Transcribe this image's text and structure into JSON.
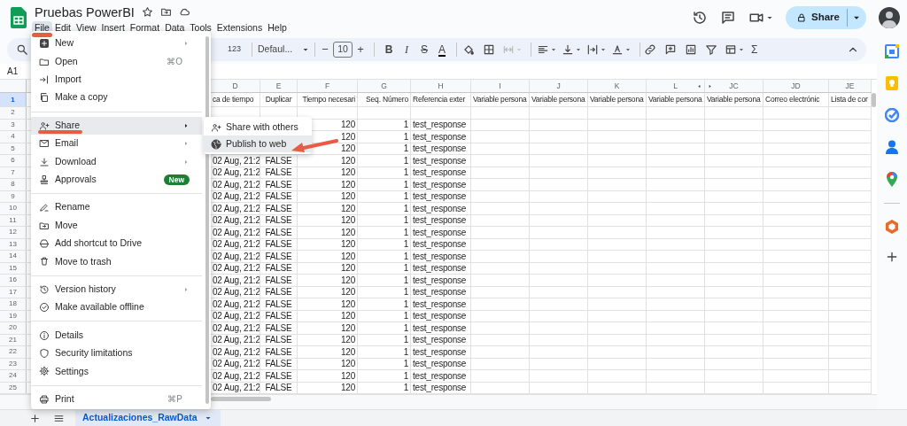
{
  "window": {
    "title": "Pruebas PowerBI"
  },
  "menu_bar": [
    {
      "label": "File",
      "selected": true,
      "annotated": true
    },
    {
      "label": "Edit",
      "selected": false,
      "annotated": false
    },
    {
      "label": "View",
      "selected": false,
      "annotated": false
    },
    {
      "label": "Insert",
      "selected": false,
      "annotated": false
    },
    {
      "label": "Format",
      "selected": false,
      "annotated": false
    },
    {
      "label": "Data",
      "selected": false,
      "annotated": false
    },
    {
      "label": "Tools",
      "selected": false,
      "annotated": false
    },
    {
      "label": "Extensions",
      "selected": false,
      "annotated": false
    },
    {
      "label": "Help",
      "selected": false,
      "annotated": false
    }
  ],
  "share_button": {
    "label": "Share"
  },
  "toolbar": {
    "number_format": "123",
    "font": "Defaul...",
    "font_size": "10",
    "decrease": "−",
    "increase": "+",
    "text_buttons": [
      {
        "glyph": "B",
        "kind": "bold"
      },
      {
        "glyph": "I",
        "kind": "italic"
      },
      {
        "glyph": "S",
        "kind": "strikethrough"
      },
      {
        "glyph": "A",
        "kind": "color"
      }
    ],
    "functions": "Σ"
  },
  "name_box": "A1",
  "file_menu": {
    "groups": [
      [
        {
          "label": "New",
          "submenu": true,
          "selected": false,
          "annotated": false
        },
        {
          "label": "Open",
          "shortcut": "⌘O",
          "submenu": false,
          "selected": false,
          "annotated": false
        },
        {
          "label": "Import",
          "submenu": false,
          "selected": false,
          "annotated": false
        },
        {
          "label": "Make a copy",
          "submenu": false,
          "selected": false,
          "annotated": false
        }
      ],
      [
        {
          "label": "Share",
          "submenu": true,
          "selected": true,
          "annotated": true
        },
        {
          "label": "Email",
          "submenu": true,
          "selected": false,
          "annotated": false
        },
        {
          "label": "Download",
          "submenu": true,
          "selected": false,
          "annotated": false
        },
        {
          "label": "Approvals",
          "submenu": false,
          "selected": false,
          "annotated": false,
          "badge": "New"
        }
      ],
      [
        {
          "label": "Rename",
          "submenu": false,
          "selected": false,
          "annotated": false
        },
        {
          "label": "Move",
          "submenu": false,
          "selected": false,
          "annotated": false
        },
        {
          "label": "Add shortcut to Drive",
          "submenu": false,
          "selected": false,
          "annotated": false
        },
        {
          "label": "Move to trash",
          "submenu": false,
          "selected": false,
          "annotated": false
        }
      ],
      [
        {
          "label": "Version history",
          "submenu": true,
          "selected": false,
          "annotated": false
        },
        {
          "label": "Make available offline",
          "submenu": false,
          "selected": false,
          "annotated": false
        }
      ],
      [
        {
          "label": "Details",
          "submenu": false,
          "selected": false,
          "annotated": false
        },
        {
          "label": "Security limitations",
          "submenu": false,
          "selected": false,
          "annotated": false
        },
        {
          "label": "Settings",
          "submenu": false,
          "selected": false,
          "annotated": false
        }
      ],
      [
        {
          "label": "Print",
          "shortcut": "⌘P",
          "submenu": false,
          "selected": false,
          "annotated": false
        }
      ]
    ]
  },
  "share_submenu": [
    {
      "label": "Share with others",
      "selected": false,
      "annotated": false
    },
    {
      "label": "Publish to web",
      "selected": true,
      "annotated": true
    }
  ],
  "sheet": {
    "columns": [
      "D",
      "E",
      "F",
      "G",
      "H",
      "I",
      "J",
      "K",
      "L",
      "JC",
      "JD",
      "JE"
    ],
    "rows": [
      {
        "number": "1",
        "selected": true,
        "cells": [
          "ca de tiempo",
          "Duplicar",
          "Tiempo necesari",
          "Seq. Número",
          "Referencia exter",
          "Variable persona",
          "Variable persona",
          "Variable persona",
          "Variable persona",
          "Variable persona",
          "Correo electrónic",
          "Lista de cor"
        ]
      },
      {
        "number": "2",
        "selected": false
      },
      {
        "number": "3",
        "selected": false,
        "covered": true,
        "cells": [
          "120",
          "1",
          "test_response"
        ]
      },
      {
        "number": "4",
        "selected": false,
        "covered": true,
        "cells": [
          "120",
          "1",
          "test_response"
        ]
      },
      {
        "number": "5",
        "selected": false,
        "covered": true,
        "cells": [
          "120",
          "1",
          "test_response"
        ]
      },
      {
        "number": "6",
        "selected": false,
        "cells": [
          "02 Aug, 21:2",
          "FALSE",
          "120",
          "1",
          "test_response"
        ]
      },
      {
        "number": "7",
        "selected": false,
        "cells": [
          "02 Aug, 21:2",
          "FALSE",
          "120",
          "1",
          "test_response"
        ]
      },
      {
        "number": "8",
        "selected": false,
        "cells": [
          "02 Aug, 21:2",
          "FALSE",
          "120",
          "1",
          "test_response"
        ]
      },
      {
        "number": "9",
        "selected": false,
        "cells": [
          "02 Aug, 21:2",
          "FALSE",
          "120",
          "1",
          "test_response"
        ]
      },
      {
        "number": "10",
        "selected": false,
        "cells": [
          "02 Aug, 21:2",
          "FALSE",
          "120",
          "1",
          "test_response"
        ]
      },
      {
        "number": "11",
        "selected": false,
        "cells": [
          "02 Aug, 21:2",
          "FALSE",
          "120",
          "1",
          "test_response"
        ]
      },
      {
        "number": "12",
        "selected": false,
        "cells": [
          "02 Aug, 21:2",
          "FALSE",
          "120",
          "1",
          "test_response"
        ]
      },
      {
        "number": "13",
        "selected": false,
        "cells": [
          "02 Aug, 21:2",
          "FALSE",
          "120",
          "1",
          "test_response"
        ]
      },
      {
        "number": "14",
        "selected": false,
        "cells": [
          "02 Aug, 21:2",
          "FALSE",
          "120",
          "1",
          "test_response"
        ]
      },
      {
        "number": "15",
        "selected": false,
        "cells": [
          "02 Aug, 21:2",
          "FALSE",
          "120",
          "1",
          "test_response"
        ]
      },
      {
        "number": "16",
        "selected": false,
        "cells": [
          "02 Aug, 21:2",
          "FALSE",
          "120",
          "1",
          "test_response"
        ]
      },
      {
        "number": "17",
        "selected": false,
        "cells": [
          "02 Aug, 21:2",
          "FALSE",
          "120",
          "1",
          "test_response"
        ]
      },
      {
        "number": "18",
        "selected": false,
        "cells": [
          "02 Aug, 21:2",
          "FALSE",
          "120",
          "1",
          "test_response"
        ]
      },
      {
        "number": "19",
        "selected": false,
        "cells": [
          "02 Aug, 21:2",
          "FALSE",
          "120",
          "1",
          "test_response"
        ]
      },
      {
        "number": "20",
        "selected": false,
        "cells": [
          "02 Aug, 21:2",
          "FALSE",
          "120",
          "1",
          "test_response"
        ]
      },
      {
        "number": "21",
        "selected": false,
        "cells": [
          "02 Aug, 21:2",
          "FALSE",
          "120",
          "1",
          "test_response"
        ]
      },
      {
        "number": "22",
        "selected": false,
        "cells": [
          "02 Aug, 21:2",
          "FALSE",
          "120",
          "1",
          "test_response"
        ]
      },
      {
        "number": "23",
        "selected": false,
        "cells": [
          "02 Aug, 21:2",
          "FALSE",
          "120",
          "1",
          "test_response"
        ]
      },
      {
        "number": "24",
        "selected": false,
        "cells": [
          "02 Aug, 21:2",
          "FALSE",
          "120",
          "1",
          "test_response"
        ]
      },
      {
        "number": "25",
        "selected": false,
        "cells": [
          "02 Aug, 21:2",
          "FALSE",
          "120",
          "1",
          "test_response"
        ]
      }
    ]
  },
  "sheet_tabs": [
    {
      "label": "Actualizaciones_RawData",
      "selected": true
    }
  ]
}
